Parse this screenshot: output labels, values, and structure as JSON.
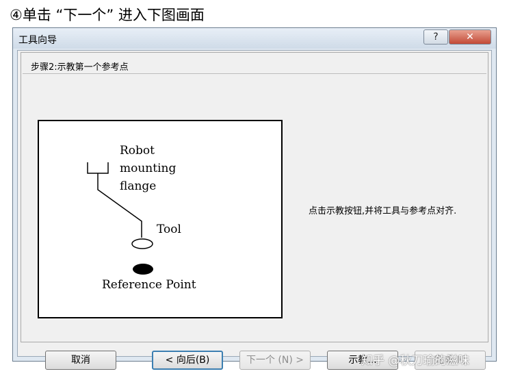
{
  "caption": "④单击 “下一个” 进入下图画面",
  "window": {
    "title": "工具向导",
    "help_label": "?",
    "close_label": "✕"
  },
  "step": {
    "title": "步骤2:示教第一个参考点"
  },
  "diagram": {
    "label_robot_line1": "Robot",
    "label_robot_line2": "mounting",
    "label_robot_line3": "flange",
    "label_tool": "Tool",
    "label_reference": "Reference Point"
  },
  "instruction": "点击示教按钮,并将工具与参考点对齐.",
  "buttons": {
    "cancel": "取消",
    "back": "< 向后(B)",
    "next": "下一个 (N) >",
    "teach": "示教...",
    "finish": "完成(F)"
  },
  "watermark": "知乎 @秋刀瑜的滋味"
}
